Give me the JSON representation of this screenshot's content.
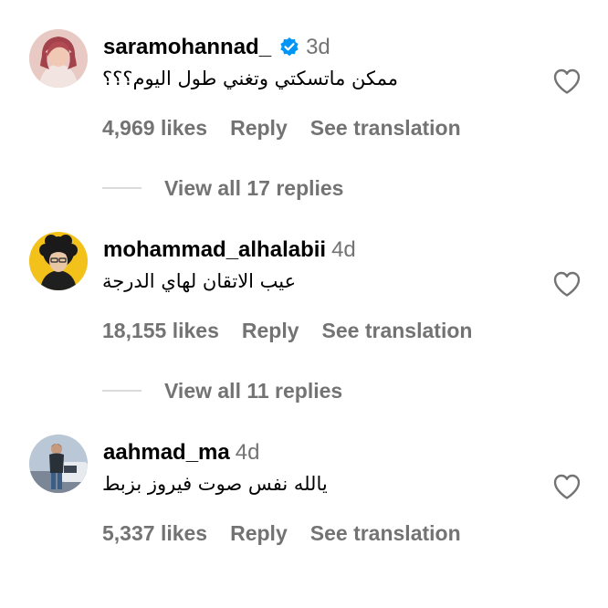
{
  "colors": {
    "text_primary": "#000000",
    "text_secondary": "#737373",
    "verified_blue": "#0095F6",
    "divider": "#DBDBDB",
    "background": "#FFFFFF"
  },
  "comments": [
    {
      "username": "saramohannad_",
      "verified": true,
      "time": "3d",
      "text": "ممكن ماتسكتي وتغني طول اليوم؟؟؟",
      "likes": "4,969 likes",
      "reply_label": "Reply",
      "translate_label": "See translation",
      "view_replies": "View all 17 replies",
      "heart_icon": "heart-outline-icon"
    },
    {
      "username": "mohammad_alhalabii",
      "verified": false,
      "time": "4d",
      "text": "عيب الاتقان لهاي الدرجة",
      "likes": "18,155 likes",
      "reply_label": "Reply",
      "translate_label": "See translation",
      "view_replies": "View all 11 replies",
      "heart_icon": "heart-outline-icon"
    },
    {
      "username": "aahmad_ma",
      "verified": false,
      "time": "4d",
      "text": "يالله نفس صوت فيروز بزبط",
      "likes": "5,337 likes",
      "reply_label": "Reply",
      "translate_label": "See translation",
      "heart_icon": "heart-outline-icon"
    }
  ]
}
